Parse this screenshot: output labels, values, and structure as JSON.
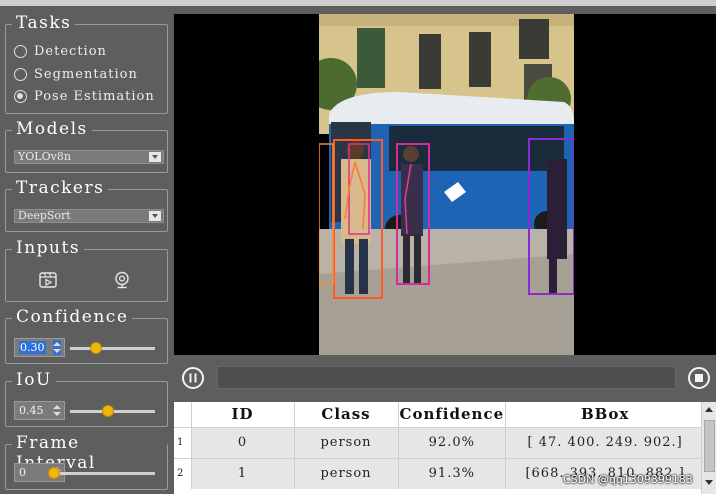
{
  "tasks": {
    "title": "Tasks",
    "options": [
      {
        "label": "Detection",
        "selected": false
      },
      {
        "label": "Segmentation",
        "selected": false
      },
      {
        "label": "Pose Estimation",
        "selected": true
      }
    ]
  },
  "models": {
    "title": "Models",
    "selected": "YOLOv8n"
  },
  "trackers": {
    "title": "Trackers",
    "selected": "DeepSort"
  },
  "inputs": {
    "title": "Inputs",
    "icons": [
      "video-file-icon",
      "webcam-icon"
    ]
  },
  "confidence": {
    "title": "Confidence",
    "value": "0.30",
    "level": 0.3
  },
  "iou": {
    "title": "IoU",
    "value": "0.45",
    "level": 0.45
  },
  "frame_interval": {
    "title": "Frame Interval",
    "value": "0",
    "level": 0.0
  },
  "controls": {
    "pause_icon": "pause-icon",
    "stop_icon": "stop-icon",
    "progress": 0.0
  },
  "table": {
    "columns": [
      "ID",
      "Class",
      "Confidence",
      "BBox"
    ],
    "rows": [
      {
        "num": "1",
        "id": "0",
        "class": "person",
        "confidence": "92.0%",
        "bbox": "[ 47. 400. 249. 902.]"
      },
      {
        "num": "2",
        "id": "1",
        "class": "person",
        "confidence": "91.3%",
        "bbox": "[668. 393. 810. 882.]"
      }
    ]
  },
  "watermark": "CSDN @qq1309399183",
  "colors": {
    "background": "#5e5e5e",
    "slider_knob": "#f2b705",
    "selection": "#2f6fd6",
    "bus_blue": "#1e64b4"
  }
}
